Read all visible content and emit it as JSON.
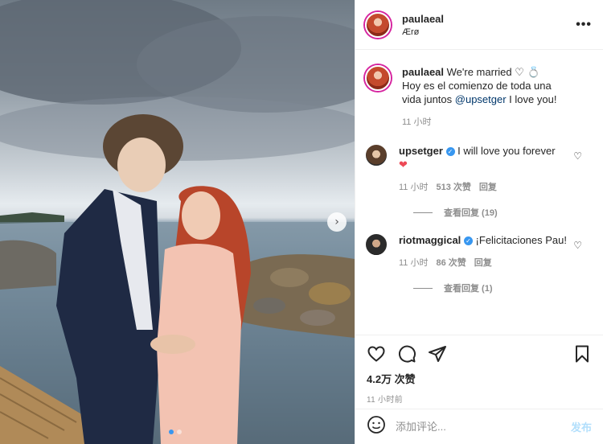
{
  "post": {
    "username": "paulaeal",
    "location": "Ærø"
  },
  "caption": {
    "username": "paulaeal",
    "text_part1": " We're married ",
    "text_part2": "Hoy es el comienzo de toda una vida juntos ",
    "mention": "@upsetger",
    "text_part3": " I love you!",
    "time": "11 小时"
  },
  "comments": [
    {
      "username": "upsetger",
      "text": "I will love you forever",
      "time": "11 小时",
      "likes": "513 次赞",
      "reply": "回复",
      "view_replies": "查看回复 (19)"
    },
    {
      "username": "riotmaggical",
      "text": "¡Felicitaciones Pau!",
      "time": "11 小时",
      "likes": "86 次赞",
      "reply": "回复",
      "view_replies": "查看回复 (1)"
    }
  ],
  "actions": {
    "like_count": "4.2万 次赞",
    "time_ago": "11 小时前"
  },
  "comment_box": {
    "placeholder": "添加评论...",
    "post_label": "发布"
  },
  "icons": {
    "like": "heart-icon",
    "comment": "comment-icon",
    "share": "share-icon",
    "save": "bookmark-icon",
    "emoji": "emoji-icon",
    "more": "more-options-icon",
    "next": "chevron-right-icon",
    "verified": "verified-badge-icon",
    "ring": "ring-icon"
  },
  "colors": {
    "verified_blue": "#3897f0",
    "heart_red": "#ed4956",
    "post_disabled": "#b2dffc"
  }
}
